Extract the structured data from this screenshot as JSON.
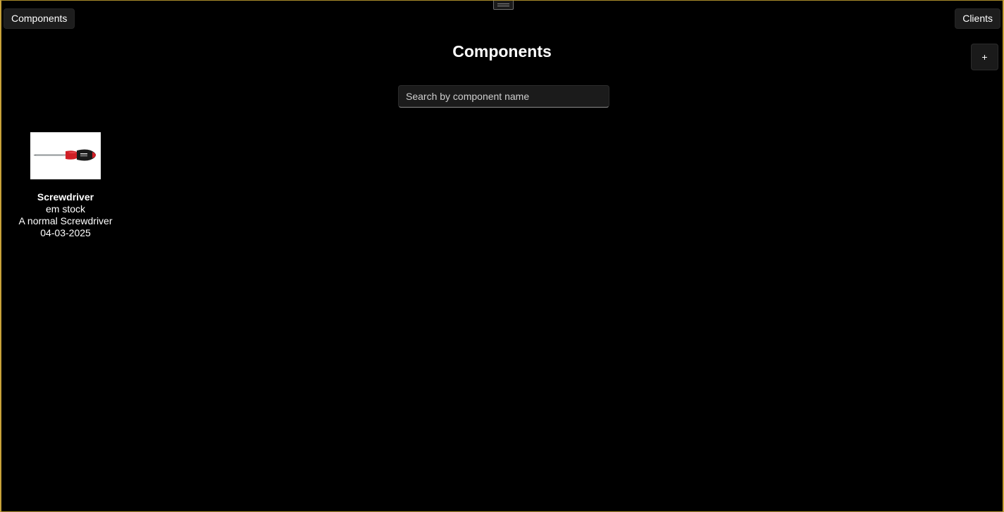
{
  "header": {
    "left_nav_label": "Components",
    "right_nav_label": "Clients",
    "title": "Components",
    "add_label": "+"
  },
  "search": {
    "placeholder": "Search by component name",
    "value": ""
  },
  "components": [
    {
      "name": "Screwdriver",
      "status": "em stock",
      "description": "A normal Screwdriver",
      "date": "04-03-2025",
      "image_icon": "screwdriver-icon"
    }
  ],
  "colors": {
    "background": "#000000",
    "window_border": "#c8a23a",
    "button_bg": "#1d1d1d",
    "text": "#ffffff",
    "screwdriver_handle": "#d01f26",
    "screwdriver_grip": "#1a1a1a"
  }
}
